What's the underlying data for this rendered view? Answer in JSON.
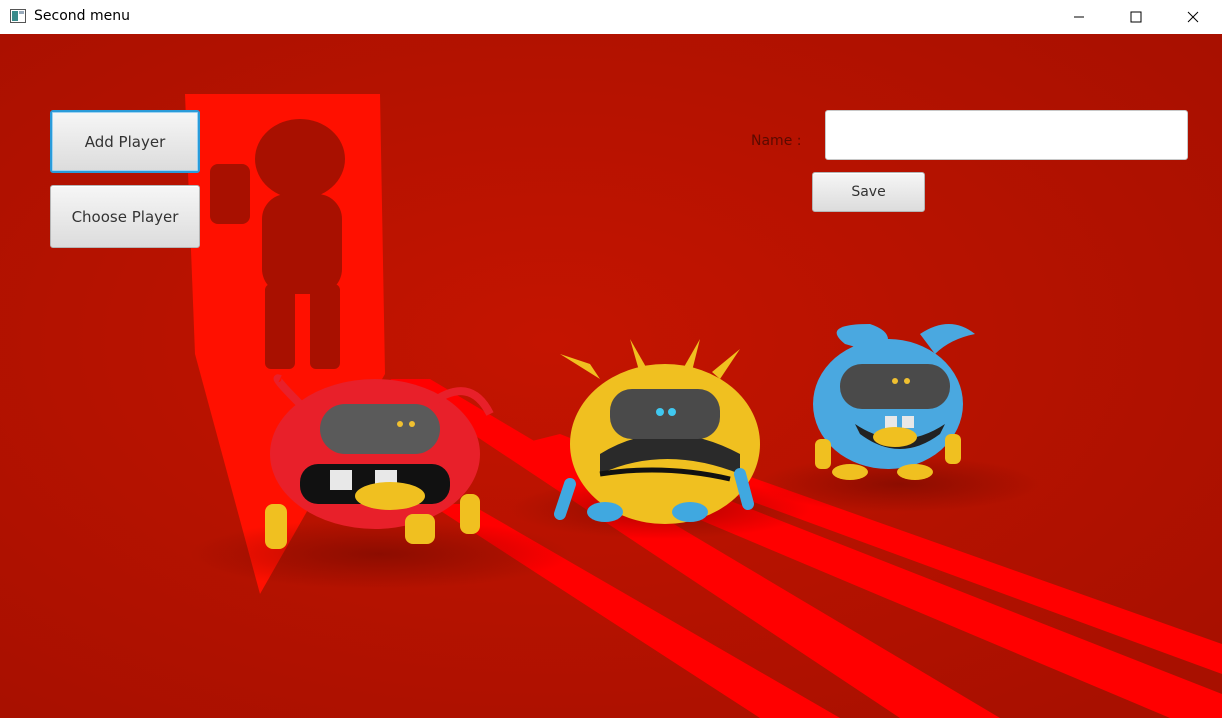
{
  "window": {
    "title": "Second menu",
    "controls": [
      "minimize-icon",
      "maximize-icon",
      "close-icon"
    ]
  },
  "menu": {
    "add_player_label": "Add Player",
    "choose_player_label": "Choose Player"
  },
  "form": {
    "name_label": "Name :",
    "name_value": "",
    "save_label": "Save"
  },
  "colors": {
    "background": "#b31200",
    "light_beam": "#ff0000",
    "focus_border": "#2a9bd9"
  }
}
